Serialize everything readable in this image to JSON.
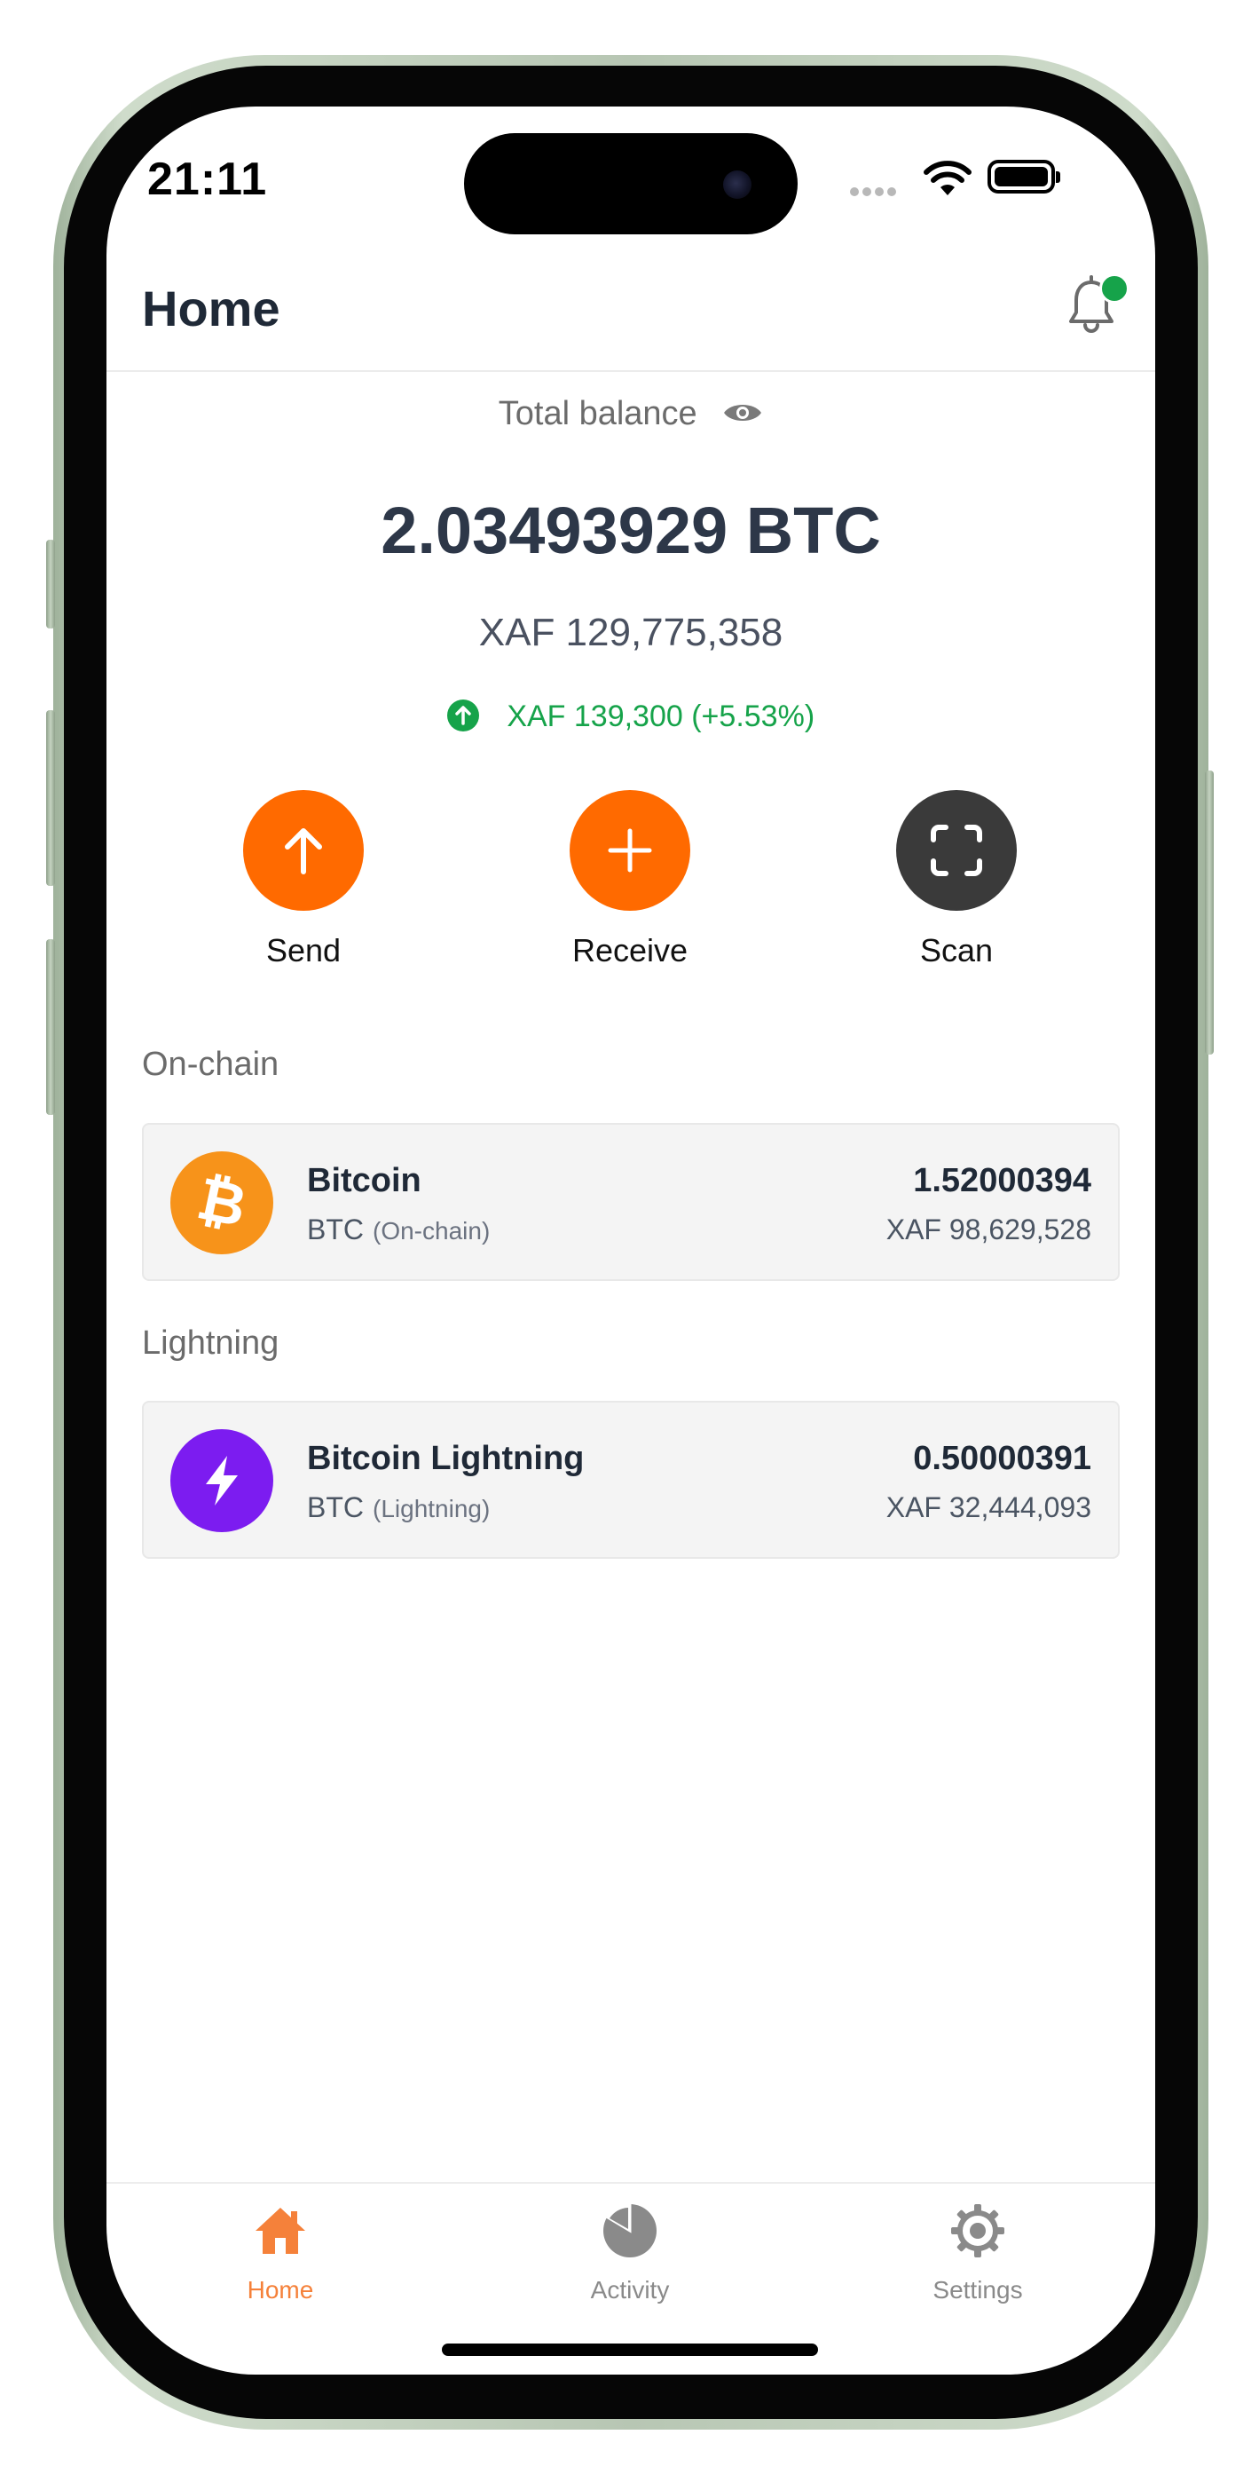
{
  "status_bar": {
    "time": "21:11"
  },
  "header": {
    "title": "Home",
    "notification_icon": "bell-icon",
    "notification_dot_color": "#16a34a"
  },
  "balance": {
    "label": "Total balance",
    "btc": "2.03493929 BTC",
    "fiat": "XAF 129,775,358",
    "change": "XAF 139,300 (+5.53%)",
    "change_color": "#16a34a"
  },
  "actions": {
    "send": {
      "label": "Send",
      "icon": "arrow-up-icon",
      "color": "#ff6a00"
    },
    "receive": {
      "label": "Receive",
      "icon": "plus-icon",
      "color": "#ff6a00"
    },
    "scan": {
      "label": "Scan",
      "icon": "scan-icon",
      "color": "#3a3a3a"
    }
  },
  "sections": {
    "onchain": {
      "label": "On-chain",
      "asset": {
        "name": "Bitcoin",
        "symbol": "BTC",
        "network": "(On-chain)",
        "amount": "1.52000394",
        "fiat": "XAF 98,629,528",
        "icon": "bitcoin-icon",
        "color": "#f7931a"
      }
    },
    "lightning": {
      "label": "Lightning",
      "asset": {
        "name": "Bitcoin Lightning",
        "symbol": "BTC",
        "network": "(Lightning)",
        "amount": "0.50000391",
        "fiat": "XAF 32,444,093",
        "icon": "lightning-icon",
        "color": "#7c1cf0"
      }
    }
  },
  "tab_bar": {
    "active_color": "#f5813a",
    "inactive_color": "#8a8a8a",
    "tabs": [
      {
        "label": "Home",
        "icon": "home-icon",
        "active": true
      },
      {
        "label": "Activity",
        "icon": "pie-chart-icon",
        "active": false
      },
      {
        "label": "Settings",
        "icon": "gear-icon",
        "active": false
      }
    ]
  }
}
